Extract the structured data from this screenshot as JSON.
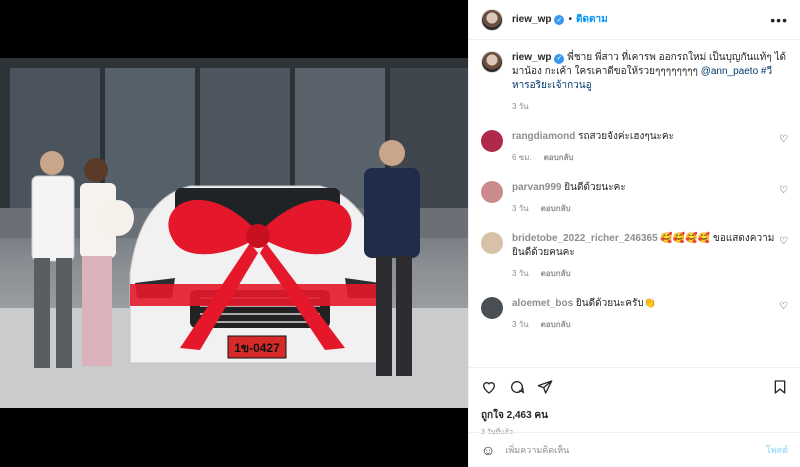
{
  "post": {
    "username": "riew_wp",
    "follow_label": "ติดตาม",
    "more_label": "•••"
  },
  "caption": {
    "username": "riew_wp",
    "text": " พี่ชาย พี่สาว ที่เคารพ ออกรถใหม่ เป็นบุญกันแท้ๆ ได้มาน้อง กะเค้า ใครเคาดีขอให้รวยๆๆๆๆๆๆๆๆ ",
    "mention": "@ann_paeto",
    "hashtag": " #วีหารอริยะเจ้ากวนอู",
    "time": "3 วัน"
  },
  "comments": [
    {
      "user": "rangdiamond",
      "text": " รถสวยจังค่ะเฮงๆนะคะ",
      "time": "6 ชม.",
      "reply": "ตอบกลับ",
      "avatar_color": "#b0284a"
    },
    {
      "user": "parvan999",
      "text": " ยินดีด้วยนะคะ",
      "time": "3 วัน",
      "reply": "ตอบกลับ",
      "avatar_color": "#c98b8b"
    },
    {
      "user": "bridetobe_2022_richer_246365",
      "text": " 🥰🥰🥰🥰 ขอแสดงความยินดีด้วยคนคะ",
      "time": "3 วัน",
      "reply": "ตอบกลับ",
      "avatar_color": "#d7c2a8"
    },
    {
      "user": "aloemet_bos",
      "text": " ยินดีด้วยนะครับ👏",
      "time": "3 วัน",
      "reply": "ตอบกลับ",
      "avatar_color": "#4a4f55"
    }
  ],
  "likes": "ถูกใจ 2,463 คน",
  "date": "3 วันที่แล้ว",
  "add_comment_placeholder": "เพิ่มความคิดเห็น",
  "post_button": "โพสต์",
  "photo": {
    "plate_text": "1ข-0427"
  },
  "icons": [
    "heart-icon",
    "comment-icon",
    "share-icon",
    "bookmark-icon",
    "emoji-icon",
    "verified-icon"
  ],
  "colors": {
    "accent": "#0095f6",
    "bow": "#e4182a",
    "car": "#f2f2f2"
  }
}
